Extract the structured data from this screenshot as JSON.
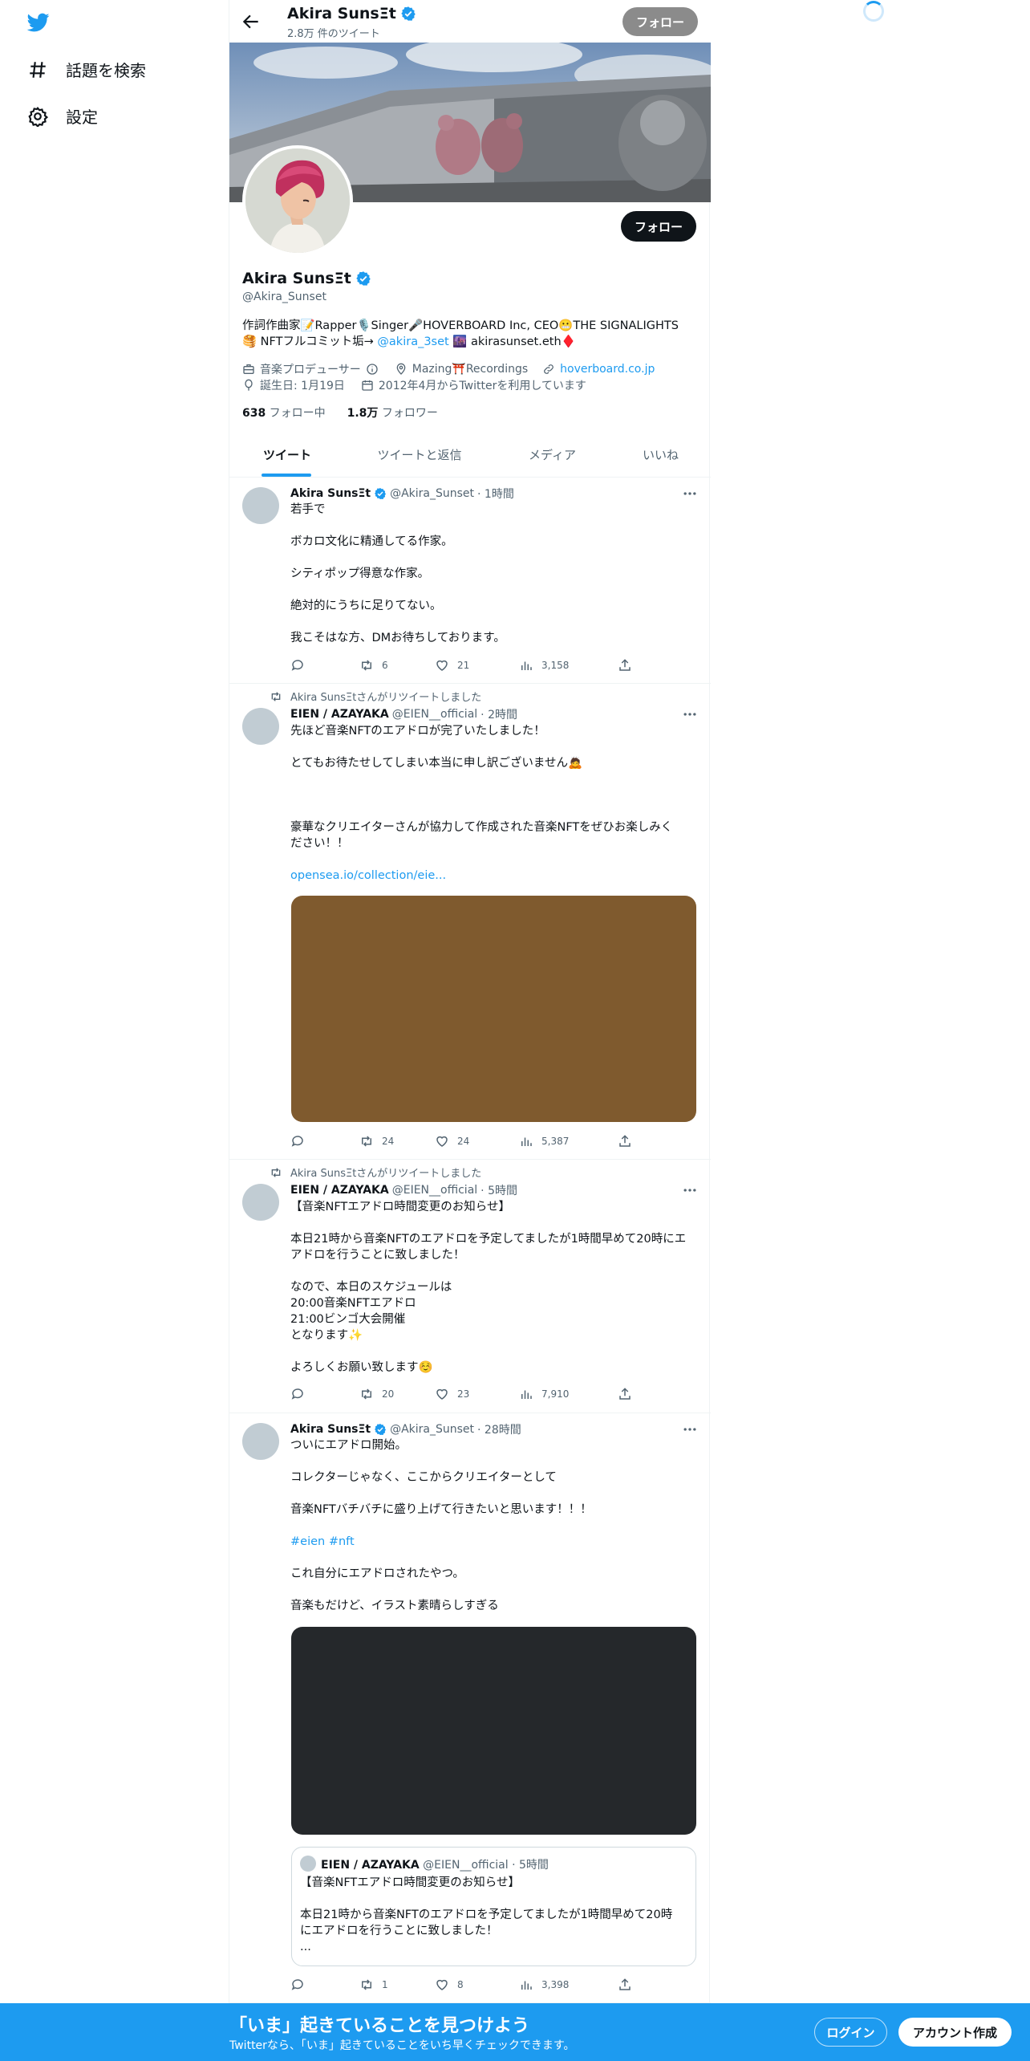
{
  "colors": {
    "accent": "#1d9bf0",
    "text": "#0f1419",
    "muted": "#536471",
    "follow_dark": "#0f1419",
    "follow_gray": "#8b8b8b"
  },
  "sidebar": {
    "logo_icon": "twitter-bird-icon",
    "items": [
      {
        "label": "話題を検索",
        "icon": "hashtag-icon"
      },
      {
        "label": "設定",
        "icon": "gear-icon"
      }
    ]
  },
  "header": {
    "name": "Akira SunsΞt",
    "tweet_count": "2.8万 件のツイート",
    "follow_label": "フォロー"
  },
  "profile": {
    "name": "Akira SunsΞt",
    "handle": "@Akira_Sunset",
    "follow_label": "フォロー",
    "bio_line1": "作詞作曲家📝Rapper🎙️Singer🎤HOVERBOARD Inc, CEO😬THE SIGNALIGHTS",
    "bio_line2_a": "🥞 NFTフルコミット垢→ ",
    "bio_mention": "@akira_3set",
    "bio_line2_b": " 🌆 akirasunset.eth♦️",
    "category": "音楽プロデューサー",
    "location": "Mazing⛩️Recordings",
    "website": "hoverboard.co.jp",
    "birthday": "誕生日: 1月19日",
    "joined": "2012年4月からTwitterを利用しています",
    "following_count": "638",
    "following_label": " フォロー中",
    "followers_count": "1.8万",
    "followers_label": " フォロワー"
  },
  "tabs": [
    "ツイート",
    "ツイートと返信",
    "メディア",
    "いいね"
  ],
  "tweets": [
    {
      "author": "Akira SunsΞt",
      "handle": "@Akira_Sunset",
      "time": "· 1時間",
      "text": "若手で\n\nボカロ文化に精通してる作家。\n\nシティポップ得意な作家。\n\n絶対的にうちに足りてない。\n\n我こそはな方、DMお待ちしております。",
      "replies": "",
      "retweets": "6",
      "likes": "21",
      "views": "3,158"
    },
    {
      "retweeted_by": "Akira SunsΞtさんがリツイートしました",
      "author": "EIEN / AZAYAKA",
      "handle": "@EIEN__official",
      "time": "· 2時間",
      "text": "先ほど音楽NFTのエアドロが完了いたしました！\n\nとてもお待たせしてしまい本当に申し訳ございません🙇\n\n\n\n豪華なクリエイターさんが協力して作成された音楽NFTをぜひお楽しみく\nださい！！",
      "link": "opensea.io/collection/eie...",
      "media_color": "#7f5a2e",
      "replies": "",
      "retweets": "24",
      "likes": "24",
      "views": "5,387"
    },
    {
      "retweeted_by": "Akira SunsΞtさんがリツイートしました",
      "author": "EIEN / AZAYAKA",
      "handle": "@EIEN__official",
      "time": "· 5時間",
      "text": "【音楽NFTエアドロ時間変更のお知らせ】\n\n本日21時から音楽NFTのエアドロを予定してましたが1時間早めて20時にエ\nアドロを行うことに致しました！\n\nなので、本日のスケジュールは\n20:00音楽NFTエアドロ\n21:00ビンゴ大会開催\nとなります✨\n\nよろしくお願い致します☺️",
      "replies": "",
      "retweets": "20",
      "likes": "23",
      "views": "7,910"
    },
    {
      "author": "Akira SunsΞt",
      "handle": "@Akira_Sunset",
      "time": "· 28時間",
      "text": "ついにエアドロ開始。\n\nコレクターじゃなく、ここからクリエイターとして\n\n音楽NFTバチバチに盛り上げて行きたいと思います！！！",
      "hashtags": "#eien #nft",
      "text2": "これ自分にエアドロされたやつ。\n\n音楽もだけど、イラスト素晴らしすぎる",
      "media_color": "#25282b",
      "quote": {
        "author": "EIEN / AZAYAKA",
        "handle": "@EIEN__official",
        "time": "· 5時間",
        "text": "【音楽NFTエアドロ時間変更のお知らせ】\n\n本日21時から音楽NFTのエアドロを予定してましたが1時間早めて20時\nにエアドロを行うことに致しました！\n..."
      },
      "replies": "",
      "retweets": "1",
      "likes": "8",
      "views": "3,398"
    }
  ],
  "bottom_bar": {
    "title": "「いま」起きていることを見つけよう",
    "subtitle": "Twitterなら、「いま」起きていることをいち早くチェックできます。",
    "login": "ログイン",
    "signup": "アカウント作成"
  }
}
